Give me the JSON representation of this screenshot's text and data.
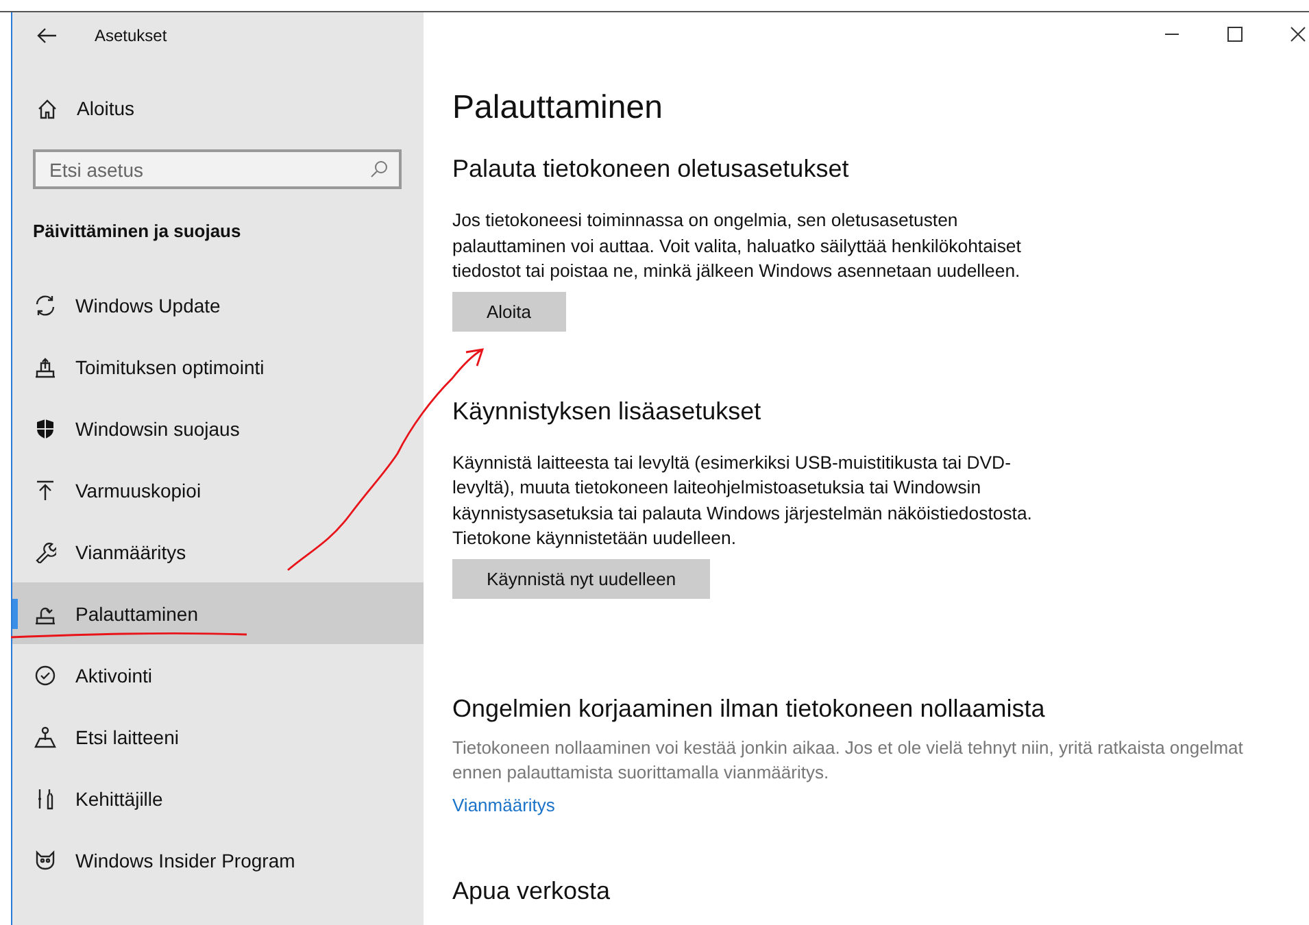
{
  "window": {
    "title": "Asetukset"
  },
  "sidebar": {
    "home": "Aloitus",
    "search": {
      "placeholder": "Etsi asetus"
    },
    "category": "Päivittäminen ja suojaus",
    "items": [
      {
        "label": "Windows Update",
        "selected": false
      },
      {
        "label": "Toimituksen optimointi",
        "selected": false
      },
      {
        "label": "Windowsin suojaus",
        "selected": false
      },
      {
        "label": "Varmuuskopioi",
        "selected": false
      },
      {
        "label": "Vianmääritys",
        "selected": false
      },
      {
        "label": "Palauttaminen",
        "selected": true
      },
      {
        "label": "Aktivointi",
        "selected": false
      },
      {
        "label": "Etsi laitteeni",
        "selected": false
      },
      {
        "label": "Kehittäjille",
        "selected": false
      },
      {
        "label": "Windows Insider Program",
        "selected": false
      }
    ]
  },
  "page": {
    "title": "Palauttaminen",
    "sections": [
      {
        "heading": "Palauta tietokoneen oletusasetukset",
        "text": "Jos tietokoneesi toiminnassa on ongelmia, sen oletusasetusten palauttaminen voi auttaa. Voit valita, haluatko säilyttää henkilökohtaiset tiedostot tai poistaa ne, minkä jälkeen Windows asennetaan uudelleen.",
        "button": "Aloita"
      },
      {
        "heading": "Käynnistyksen lisäasetukset",
        "text": "Käynnistä laitteesta tai levyltä (esimerkiksi USB-muistitikusta tai DVD-levyltä), muuta tietokoneen laiteohjelmistoasetuksia tai Windowsin käynnistysasetuksia tai palauta Windows järjestelmän näköistiedostosta. Tietokone käynnistetään uudelleen.",
        "button": "Käynnistä nyt uudelleen"
      },
      {
        "heading": "Ongelmien korjaaminen ilman tietokoneen nollaamista",
        "note": "Tietokoneen nollaaminen voi kestää jonkin aikaa. Jos et ole vielä tehnyt niin, yritä ratkaista ongelmat ennen palauttamista suorittamalla vianmääritys.",
        "link": "Vianmääritys"
      },
      {
        "heading": "Apua verkosta"
      }
    ]
  }
}
